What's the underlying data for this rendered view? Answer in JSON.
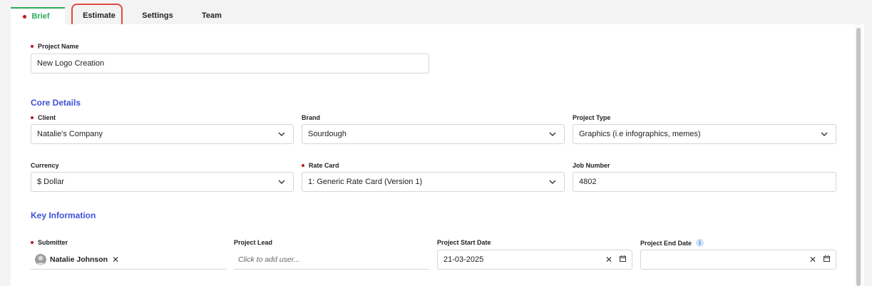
{
  "tabs": {
    "brief": "Brief",
    "estimate": "Estimate",
    "settings": "Settings",
    "team": "Team"
  },
  "project_name": {
    "label": "Project Name",
    "value": "New Logo Creation"
  },
  "core_details": {
    "title": "Core Details",
    "client": {
      "label": "Client",
      "value": "Natalie's Company"
    },
    "brand": {
      "label": "Brand",
      "value": "Sourdough"
    },
    "project_type": {
      "label": "Project Type",
      "value": "Graphics (i.e infographics, memes)"
    },
    "currency": {
      "label": "Currency",
      "value": "$ Dollar"
    },
    "rate_card": {
      "label": "Rate Card",
      "value": "1: Generic Rate Card (Version 1)"
    },
    "job_number": {
      "label": "Job Number",
      "value": "4802"
    }
  },
  "key_information": {
    "title": "Key Information",
    "submitter": {
      "label": "Submitter",
      "user": "Natalie Johnson"
    },
    "project_lead": {
      "label": "Project Lead",
      "placeholder": "Click to add user..."
    },
    "start_date": {
      "label": "Project Start Date",
      "value": "21-03-2025"
    },
    "end_date": {
      "label": "Project End Date",
      "value": ""
    }
  },
  "colors": {
    "accent_blue": "#3f51d8",
    "active_tab_green": "#2eaa5c",
    "required_red": "#c0161b",
    "highlight_red": "#de4b3e"
  },
  "icons": [
    "chevron-down-icon",
    "close-icon",
    "calendar-icon",
    "info-icon",
    "avatar"
  ]
}
